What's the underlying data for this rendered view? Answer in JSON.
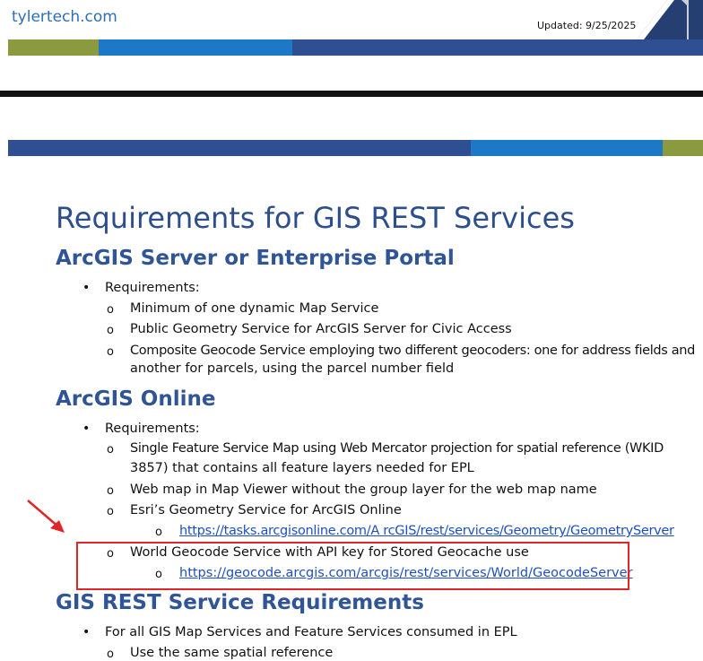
{
  "header": {
    "brand": "tylertech.com",
    "updated": "Updated: 9/25/2025",
    "colors": {
      "olive": "#8c9a3f",
      "blue": "#1e78c8",
      "navy": "#2f4f93",
      "dark_navy": "#253f72"
    }
  },
  "document": {
    "title": "Requirements for GIS REST Services",
    "sections": [
      {
        "heading": "ArcGIS Server or Enterprise Portal",
        "bullet": "Requirements:",
        "items": [
          "Minimum of one dynamic Map Service",
          "Public Geometry Service for ArcGIS Server for Civic Access",
          "Composite Geocode Service employing two different geocoders: one for address fields and",
          "another for parcels, using the parcel number field"
        ]
      },
      {
        "heading": "ArcGIS Online",
        "bullet": "Requirements:",
        "items": [
          "Single Feature Service Map using Web Mercator projection for spatial reference (WKID",
          "3857) that contains all feature layers needed for EPL",
          "Web map in Map Viewer without the group layer for the web map name",
          "Esri’s Geometry Service for ArcGIS Online",
          "World Geocode Service with API key for Stored Geocache use"
        ],
        "links": [
          "https://tasks.arcgisonline.com/A rcGIS/rest/services/Geometry/GeometryServer",
          "https://geocode.arcgis.com/arcgis/rest/services/World/GeocodeServer"
        ]
      },
      {
        "heading": "GIS REST Service Requirements",
        "bullet": "For all GIS Map Services and Feature Services consumed in EPL",
        "items": [
          "Use the same spatial reference"
        ]
      }
    ]
  },
  "glyphs": {
    "bullet": "•",
    "sub": "o"
  },
  "annotation_colors": {
    "arrow": "#e0262a",
    "box": "#e0262a"
  }
}
